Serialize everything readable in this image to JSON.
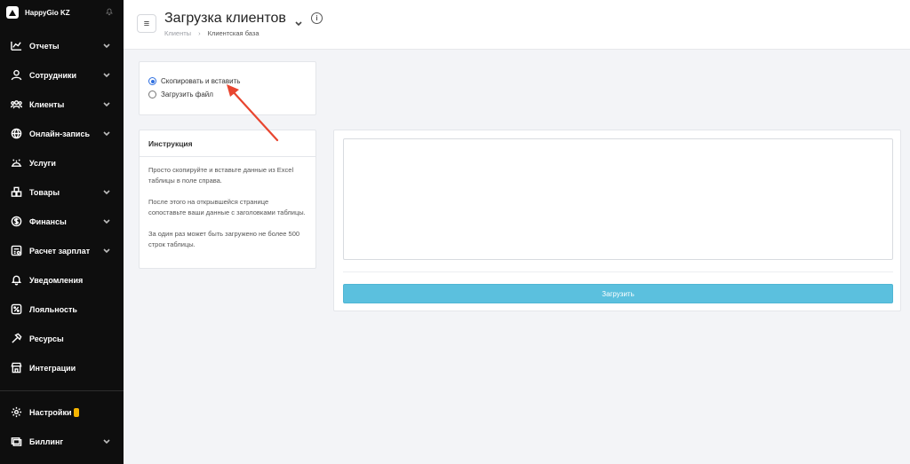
{
  "brand": {
    "name": "HappyGio KZ"
  },
  "sidebar": {
    "items": [
      {
        "label": "Отчеты",
        "icon": "chart-icon",
        "chevron": true
      },
      {
        "label": "Сотрудники",
        "icon": "user-icon",
        "chevron": true
      },
      {
        "label": "Клиенты",
        "icon": "users-icon",
        "chevron": true
      },
      {
        "label": "Онлайн-запись",
        "icon": "globe-icon",
        "chevron": true
      },
      {
        "label": "Услуги",
        "icon": "service-icon",
        "chevron": false
      },
      {
        "label": "Товары",
        "icon": "box-icon",
        "chevron": true
      },
      {
        "label": "Финансы",
        "icon": "dollar-icon",
        "chevron": true
      },
      {
        "label": "Расчет зарплат",
        "icon": "calc-icon",
        "chevron": true
      },
      {
        "label": "Уведомления",
        "icon": "bell-icon",
        "chevron": false
      },
      {
        "label": "Лояльность",
        "icon": "percent-icon",
        "chevron": false
      },
      {
        "label": "Ресурсы",
        "icon": "hammer-icon",
        "chevron": false
      },
      {
        "label": "Интеграции",
        "icon": "store-icon",
        "chevron": false
      }
    ],
    "bottom": [
      {
        "label": "Настройки",
        "icon": "gear-icon",
        "chevron": false,
        "badge": true
      },
      {
        "label": "Биллинг",
        "icon": "billing-icon",
        "chevron": true
      }
    ]
  },
  "header": {
    "title": "Загрузка клиентов",
    "breadcrumb": [
      "Клиенты",
      "Клиентская база"
    ]
  },
  "options": {
    "paste_label": "Скопировать и вставить",
    "file_label": "Загрузить файл",
    "selected": "paste"
  },
  "instructions": {
    "title": "Инструкция",
    "p1": "Просто скопируйте и вставьте данные из Excel таблицы в поле справа.",
    "p2": "После этого на открывшейся странице сопоставьте ваши данные с заголовками таблицы.",
    "p3": "За один раз может быть загружено не более 500 строк таблицы."
  },
  "upload": {
    "button_label": "Загрузить",
    "textarea_value": ""
  },
  "colors": {
    "accent": "#5bc0de",
    "sidebar": "#0e0e0e",
    "annotation": "#e8452f"
  }
}
